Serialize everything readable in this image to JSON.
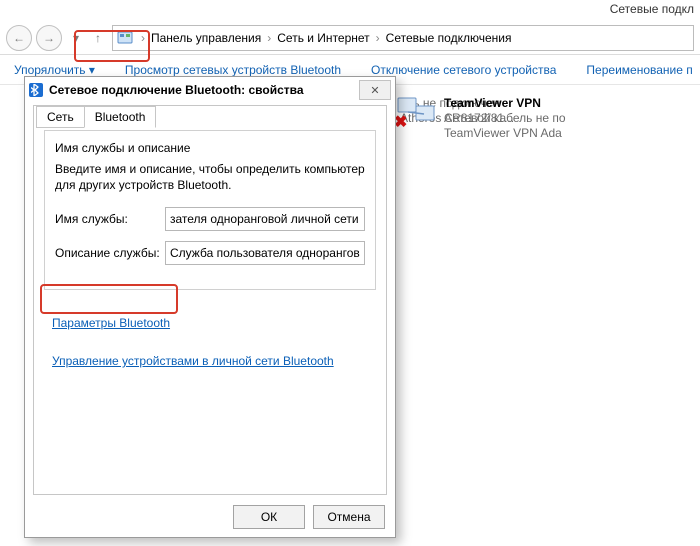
{
  "outer_window": {
    "title_fragment": "Сетевые подкл"
  },
  "breadcrumb": {
    "items": [
      "Панель управления",
      "Сеть и Интернет",
      "Сетевые подключения"
    ]
  },
  "toolbar": {
    "organize": "Упорялочить",
    "view_bt": "Просмотр сетевых устройств Bluetooth",
    "disable": "Отключение сетевого устройства",
    "rename": "Переименование п"
  },
  "peek_device1": {
    "line1": "ель не подключен",
    "line2": "Atheros AR8172/81..."
  },
  "device2": {
    "title": "TeamViewer VPN",
    "line2": "Сетевой кабель не по",
    "line3": "TeamViewer VPN Ada"
  },
  "dialog": {
    "title": "Сетевое подключение Bluetooth: свойства",
    "tabs": {
      "t1": "Сеть",
      "t2": "Bluetooth"
    },
    "panel": {
      "heading": "Имя службы и описание",
      "help": "Введите имя и описание, чтобы определить компьютер для других устройств Bluetooth.",
      "name_label": "Имя службы:",
      "name_value": "зателя одноранговой личной сети",
      "desc_label": "Описание службы:",
      "desc_value": "Служба пользователя одноранговой"
    },
    "link1": "Параметры Bluetooth",
    "link2": "Управление устройствами в личной сети Bluetooth",
    "ok": "ОК",
    "cancel": "Отмена"
  }
}
